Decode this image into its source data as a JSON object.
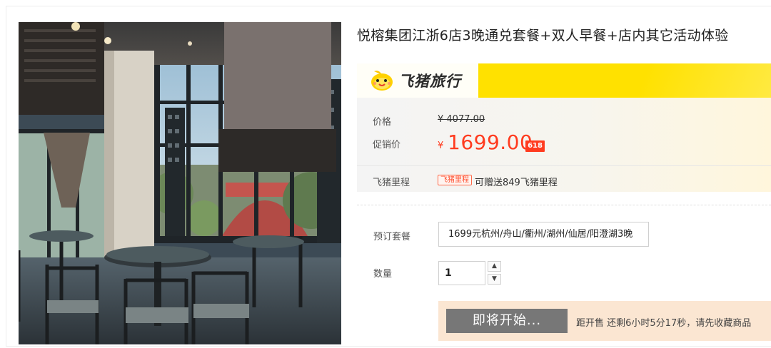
{
  "product": {
    "title": "悦榕集团江浙6店3晚通兑套餐+双人早餐+店内其它活动体验",
    "image_alt": "hotel restaurant interior"
  },
  "brand": {
    "name": "飞猪旅行",
    "icon": "fliggy-logo-icon",
    "accent_color": "#ffe100"
  },
  "price": {
    "label": "价格",
    "original": "¥ 4077.00"
  },
  "promo": {
    "label": "促销价",
    "currency": "¥",
    "value": "1699.00",
    "badge": "618",
    "color": "#ff3b1f"
  },
  "miles": {
    "label": "飞猪里程",
    "tag": "飞猪里程",
    "text": "可赠送849飞猪里程"
  },
  "package": {
    "label": "预订套餐",
    "selected": "1699元杭州/舟山/衢州/湖州/仙居/阳澄湖3晚"
  },
  "quantity": {
    "label": "数量",
    "value": "1",
    "increment_icon": "^",
    "decrement_icon": "v"
  },
  "sale": {
    "button_label": "即将开始...",
    "note": "距开售 还剩6小时5分17秒，请先收藏商品"
  }
}
